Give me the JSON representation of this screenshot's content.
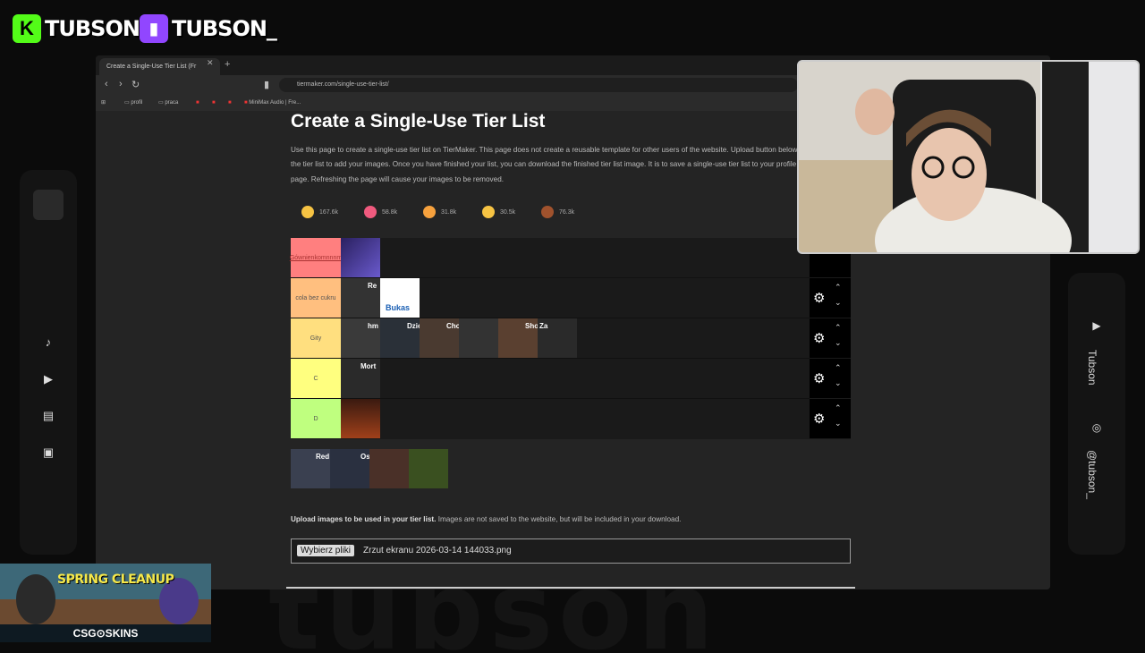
{
  "overlay": {
    "kick_handle": "TUBSON",
    "twitch_handle": "TUBSON_",
    "watermark": "tubson",
    "right_bar": {
      "youtube_label": "Tubson",
      "instagram_label": "@tubson_"
    },
    "sponsor": {
      "title": "SPRING CLEANUP",
      "brand": "CSG⊙SKINS"
    },
    "colors": {
      "kick": "#53fc18",
      "twitch": "#9146ff"
    }
  },
  "browser": {
    "tab_title": "Create a Single-Use Tier List (Fr",
    "url": "tiermaker.com/single-use-tier-list/",
    "bookmarks": [
      "profil",
      "praca",
      "MiniMax Audio | Fre..."
    ]
  },
  "page": {
    "title": "Create a Single-Use Tier List",
    "description": "Use this page to create a single-use tier list on TierMaker. This page does not create a reusable template for other users of the website. Upload button below the tier list to add your images. Once you have finished your list, you can download the finished tier list image. It is to save a single-use tier list to your profile page. Refreshing the page will cause your images to be removed.",
    "reactions": [
      {
        "count": "167.6k",
        "color": "#f6c343"
      },
      {
        "count": "58.8k",
        "color": "#f05a7e"
      },
      {
        "count": "31.8k",
        "color": "#f6a13d"
      },
      {
        "count": "30.5k",
        "color": "#f6c343"
      },
      {
        "count": "76.3k",
        "color": "#a0522d"
      }
    ],
    "tiers": [
      {
        "label": "Gównienkomnnnm",
        "color": "#ff7f7f",
        "items": [
          "",
          ""
        ]
      },
      {
        "label": "cola bez cukru",
        "color": "#ffbf7f",
        "items": [
          "Re",
          "Bukas"
        ]
      },
      {
        "label": "Gity",
        "color": "#ffdf7f",
        "items": [
          "hm",
          "Dzie",
          "Cho",
          "",
          "Sho",
          "Za"
        ]
      },
      {
        "label": "C",
        "color": "#ffff7f",
        "items": [
          "Mort"
        ]
      },
      {
        "label": "D",
        "color": "#bfff7f",
        "items": [
          ""
        ]
      }
    ],
    "pool_items": [
      "Red",
      "Os",
      "",
      ""
    ],
    "upload_label_bold": "Upload images to be used in your tier list.",
    "upload_label_rest": " Images are not saved to the website, but will be included in your download.",
    "file_button": "Wybierz pliki",
    "file_name": "Zrzut ekranu 2026-03-14 144033.png"
  }
}
